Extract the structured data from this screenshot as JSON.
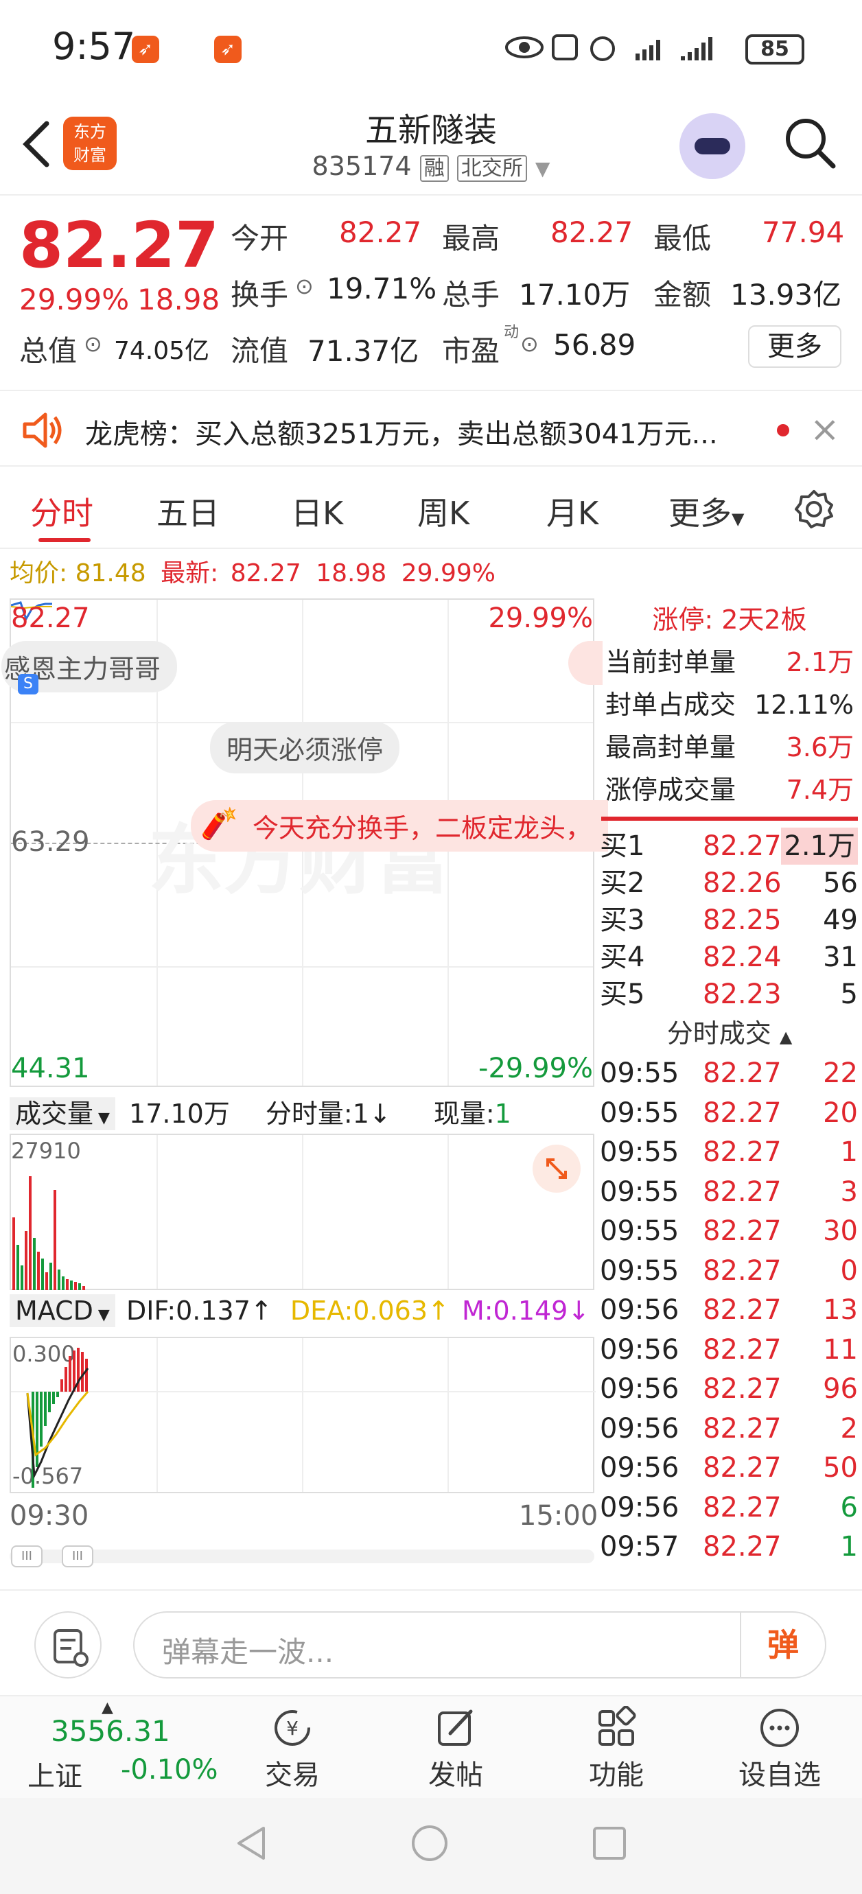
{
  "status_bar": {
    "time": "9:57",
    "battery": "85"
  },
  "header": {
    "back_icon": "chevron-left-icon",
    "logo_line1": "东方",
    "logo_line2": "财富",
    "title": "五新隧装",
    "code": "835174",
    "tag_margin": "融",
    "tag_exchange": "北交所"
  },
  "quote": {
    "price": "82.27",
    "change_pct": "29.99%",
    "change_abs": "18.98",
    "open_label": "今开",
    "open": "82.27",
    "high_label": "最高",
    "high": "82.27",
    "low_label": "最低",
    "low": "77.94",
    "turnover_label": "换手",
    "turnover": "19.71%",
    "volume_label": "总手",
    "volume": "17.10万",
    "amount_label": "金额",
    "amount": "13.93亿",
    "total_value_label": "总值",
    "total_value": "74.05亿",
    "float_value_label": "流值",
    "float_value": "71.37亿",
    "pe_label": "市盈",
    "pe_superscript": "动",
    "pe": "56.89",
    "more_label": "更多"
  },
  "news": {
    "text": "龙虎榜：买入总额3251万元，卖出总额3041万元..."
  },
  "tabs": [
    "分时",
    "五日",
    "日K",
    "周K",
    "月K",
    "更多"
  ],
  "chart_header": {
    "avg_label": "均价:",
    "avg": "81.48",
    "latest_label": "最新:",
    "latest": "82.27",
    "change_abs": "18.98",
    "change_pct": "29.99%"
  },
  "intraday": {
    "top_price": "82.27",
    "top_pct": "29.99%",
    "mid_price": "63.29",
    "bottom_price": "44.31",
    "bottom_pct": "-29.99%",
    "danmaku1": "感恩主力哥哥",
    "danmaku2": "明天必须涨停",
    "danmaku3": "今天充分换手，二板定龙头，",
    "watermark": "东方财富"
  },
  "volume_bar": {
    "label": "成交量",
    "total": "17.10万",
    "mode": "分时量:1↓",
    "now_label": "现量:",
    "now": "1",
    "max": "27910"
  },
  "macd_bar": {
    "label": "MACD",
    "dif": "DIF:0.137↑",
    "dea": "DEA:0.063↑",
    "m": "M:0.149↓",
    "top": "0.300",
    "bottom": "-0.567"
  },
  "time_axis": {
    "start": "09:30",
    "end": "15:00"
  },
  "limit_up": {
    "title": "涨停:  2天2板",
    "rows": [
      {
        "label": "当前封单量",
        "value": "2.1万"
      },
      {
        "label": "封单占成交",
        "value": "12.11%"
      },
      {
        "label": "最高封单量",
        "value": "3.6万"
      },
      {
        "label": "涨停成交量",
        "value": "7.4万"
      }
    ]
  },
  "order_book": [
    {
      "label": "买1",
      "price": "82.27",
      "vol": "2.1万"
    },
    {
      "label": "买2",
      "price": "82.26",
      "vol": "56"
    },
    {
      "label": "买3",
      "price": "82.25",
      "vol": "49"
    },
    {
      "label": "买4",
      "price": "82.24",
      "vol": "31"
    },
    {
      "label": "买5",
      "price": "82.23",
      "vol": "5"
    }
  ],
  "trades_header": "分时成交",
  "trades": [
    {
      "time": "09:55",
      "price": "82.27",
      "vol": "22",
      "dir": "buy"
    },
    {
      "time": "09:55",
      "price": "82.27",
      "vol": "20",
      "dir": "buy"
    },
    {
      "time": "09:55",
      "price": "82.27",
      "vol": "1",
      "dir": "buy"
    },
    {
      "time": "09:55",
      "price": "82.27",
      "vol": "3",
      "dir": "buy"
    },
    {
      "time": "09:55",
      "price": "82.27",
      "vol": "30",
      "dir": "buy"
    },
    {
      "time": "09:55",
      "price": "82.27",
      "vol": "0",
      "dir": "buy"
    },
    {
      "time": "09:56",
      "price": "82.27",
      "vol": "13",
      "dir": "buy"
    },
    {
      "time": "09:56",
      "price": "82.27",
      "vol": "11",
      "dir": "buy"
    },
    {
      "time": "09:56",
      "price": "82.27",
      "vol": "96",
      "dir": "buy"
    },
    {
      "time": "09:56",
      "price": "82.27",
      "vol": "2",
      "dir": "buy"
    },
    {
      "time": "09:56",
      "price": "82.27",
      "vol": "50",
      "dir": "buy"
    },
    {
      "time": "09:56",
      "price": "82.27",
      "vol": "6",
      "dir": "sell"
    },
    {
      "time": "09:57",
      "price": "82.27",
      "vol": "1",
      "dir": "sell"
    }
  ],
  "danmaku_input": {
    "placeholder": "弹幕走一波...",
    "send_label": "弹"
  },
  "bottom_nav": {
    "index_value": "3556.31",
    "index_name": "上证",
    "index_change": "-0.10%",
    "items": [
      "交易",
      "发帖",
      "功能",
      "设自选"
    ]
  },
  "colors": {
    "up": "#e0272e",
    "down": "#149a3c",
    "brand": "#f05a1c",
    "avg_line": "#e6b800"
  }
}
